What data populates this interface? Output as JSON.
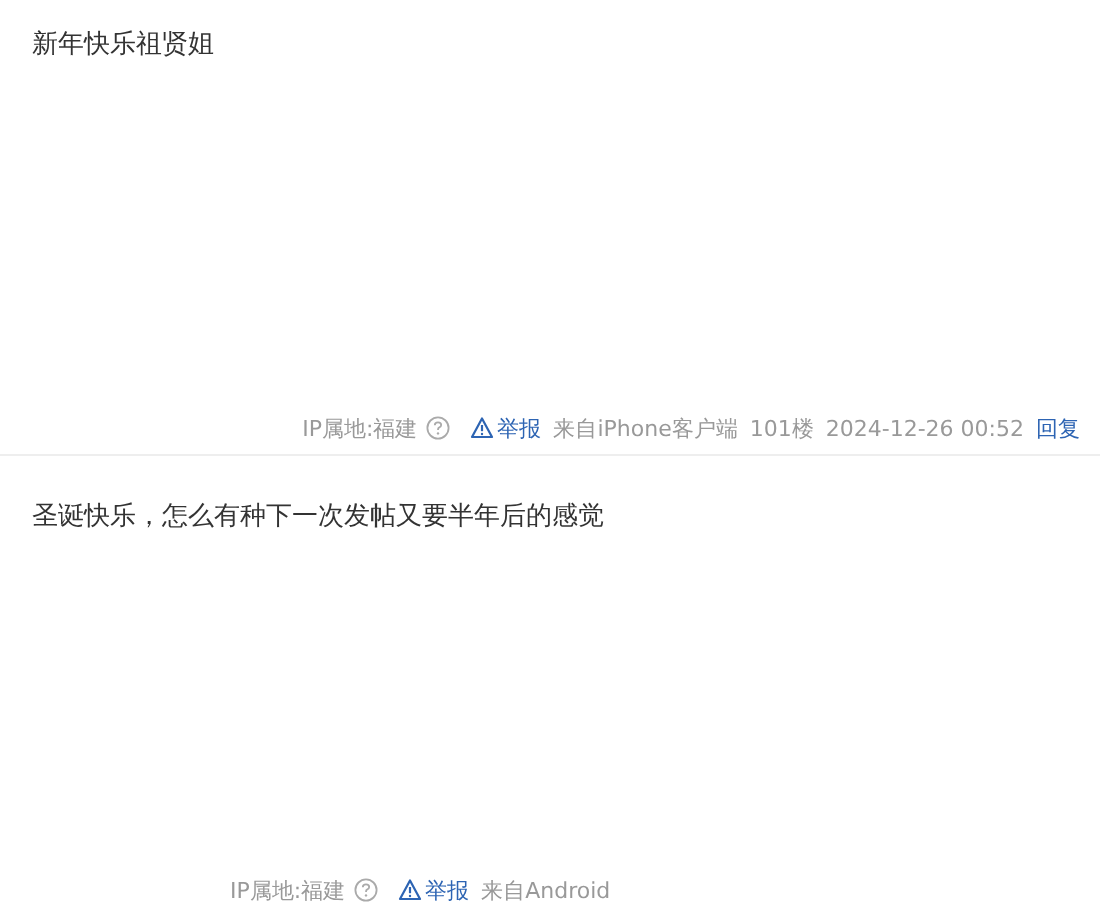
{
  "posts": [
    {
      "content": "新年快乐祖贤姐",
      "footer": {
        "ip": "IP属地:福建",
        "report": "举报",
        "source": "来自iPhone客户端",
        "floor": "101楼",
        "time": "2024-12-26 00:52",
        "reply": "回复"
      }
    },
    {
      "content": "圣诞快乐，怎么有种下一次发帖又要半年后的感觉",
      "footer": {
        "ip": "IP属地:福建",
        "report": "举报",
        "source": "来自Android"
      }
    }
  ]
}
